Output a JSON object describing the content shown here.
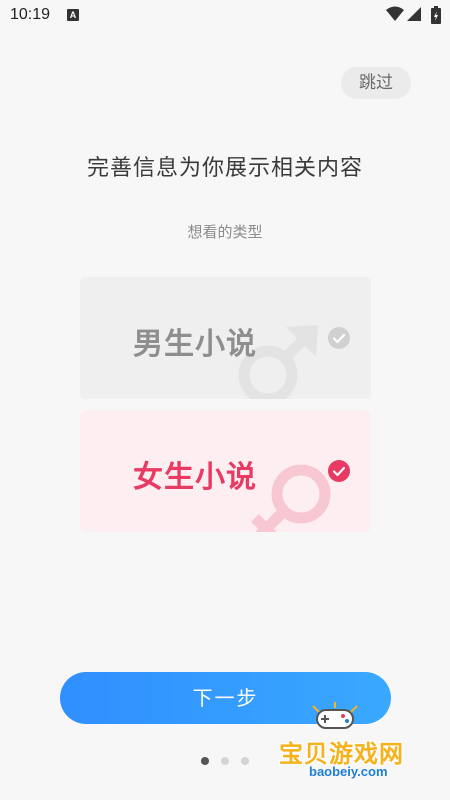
{
  "status_bar": {
    "time": "10:19",
    "notification_icon_letter": "A",
    "icons": [
      "wifi-icon",
      "signal-icon",
      "battery-icon"
    ]
  },
  "skip_label": "跳过",
  "title": "完善信息为你展示相关内容",
  "subtitle": "想看的类型",
  "options": [
    {
      "label": "男生小说",
      "selected": false,
      "icon": "male-symbol-icon",
      "color": "#8e8e8e"
    },
    {
      "label": "女生小说",
      "selected": true,
      "icon": "female-symbol-icon",
      "color": "#e83a63"
    }
  ],
  "next_label": "下一步",
  "pager": {
    "count": 3,
    "active_index": 0
  },
  "watermark": {
    "text": "宝贝游戏网",
    "url": "baobeiy.com"
  },
  "colors": {
    "accent_blue": "#3aa8ff",
    "accent_pink": "#e83a63"
  }
}
